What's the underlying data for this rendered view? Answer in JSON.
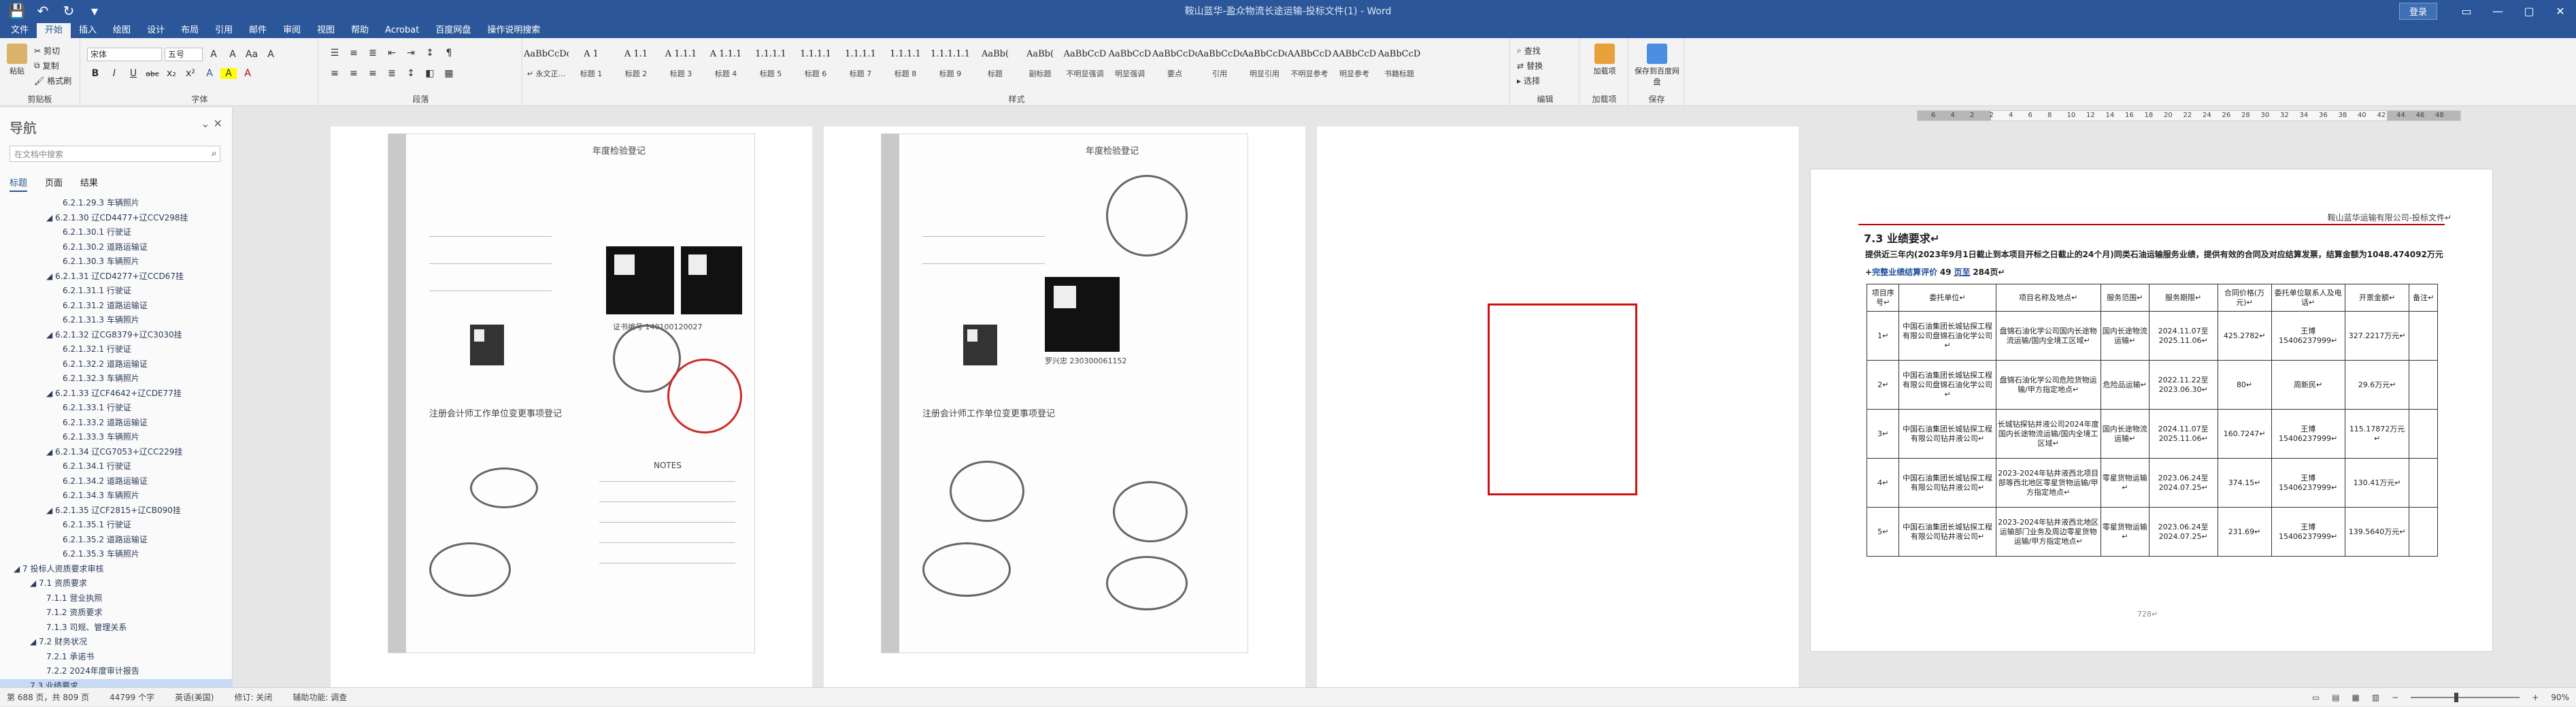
{
  "title_bar": {
    "document_title": "鞍山蓝华-盈众物流长途运输-投标文件(1)  -  Word",
    "sign_in_label": "登录",
    "qat": [
      "💾",
      "↶",
      "↻",
      "▾"
    ],
    "window_controls": [
      "▭",
      "—",
      "▢",
      "✕"
    ]
  },
  "menu": {
    "tabs": [
      "文件",
      "开始",
      "插入",
      "绘图",
      "设计",
      "布局",
      "引用",
      "邮件",
      "审阅",
      "视图",
      "帮助",
      "Acrobat",
      "百度网盘",
      "操作说明搜索"
    ],
    "active_index": 1
  },
  "ribbon": {
    "clipboard": {
      "paste": "粘贴",
      "cut": "剪切",
      "copy": "复制",
      "format_painter": "格式刷",
      "group": "剪贴板"
    },
    "font": {
      "name": "宋体",
      "size": "五号",
      "group": "字体",
      "format_buttons": [
        "B",
        "I",
        "U",
        "abc",
        "x₂",
        "x²",
        "A",
        "A",
        "A"
      ]
    },
    "paragraph": {
      "group": "段落"
    },
    "styles": {
      "group": "样式",
      "items": [
        {
          "sample": "AaBbCcDd",
          "name": "↵ 永文正..."
        },
        {
          "sample": "A 1",
          "name": "标题 1"
        },
        {
          "sample": "A 1.1",
          "name": "标题 2"
        },
        {
          "sample": "A 1.1.1",
          "name": "标题 3"
        },
        {
          "sample": "A 1.1.1",
          "name": "标题 4"
        },
        {
          "sample": "1.1.1.1",
          "name": "标题 5"
        },
        {
          "sample": "1.1.1.1",
          "name": "标题 6"
        },
        {
          "sample": "1.1.1.1",
          "name": "标题 7"
        },
        {
          "sample": "1.1.1.1",
          "name": "标题 8"
        },
        {
          "sample": "1.1.1.1.1",
          "name": "标题 9"
        },
        {
          "sample": "AaBb(",
          "name": "标题"
        },
        {
          "sample": "AaBb(",
          "name": "副标题"
        },
        {
          "sample": "AaBbCcD",
          "name": "不明显强调"
        },
        {
          "sample": "AaBbCcD",
          "name": "明显强调"
        },
        {
          "sample": "AaBbCcDd",
          "name": "要点"
        },
        {
          "sample": "AaBbCcDd",
          "name": "引用"
        },
        {
          "sample": "AaBbCcDd",
          "name": "明显引用"
        },
        {
          "sample": "AABbCcD",
          "name": "不明显参考"
        },
        {
          "sample": "AABbCcD",
          "name": "明显参考"
        },
        {
          "sample": "AaBbCcD",
          "name": "书籍标题"
        }
      ]
    },
    "editing": {
      "find": "查找",
      "replace": "替换",
      "select": "选择",
      "group": "编辑"
    },
    "addin": {
      "label": "加载项",
      "group": "加载项"
    },
    "save": {
      "label": "保存到百度网盘",
      "group": "保存"
    }
  },
  "ruler": {
    "numbers": [
      "6",
      "4",
      "2",
      "2",
      "4",
      "6",
      "8",
      "10",
      "12",
      "14",
      "16",
      "18",
      "20",
      "22",
      "24",
      "26",
      "28",
      "30",
      "32",
      "34",
      "36",
      "38",
      "40",
      "42",
      "44",
      "46",
      "48"
    ]
  },
  "nav": {
    "title": "导航",
    "search_placeholder": "在文档中搜索",
    "tabs": [
      "标题",
      "页面",
      "结果"
    ],
    "items": [
      {
        "text": "6.2.1.29.3  车辆照片",
        "indent": 3
      },
      {
        "text": "◢ 6.2.1.30 辽CD4477+辽CCV298挂",
        "indent": 2
      },
      {
        "text": "6.2.1.30.1  行驶证",
        "indent": 3
      },
      {
        "text": "6.2.1.30.2  道路运输证",
        "indent": 3
      },
      {
        "text": "6.2.1.30.3  车辆照片",
        "indent": 3
      },
      {
        "text": "◢ 6.2.1.31 辽CD4277+辽CCD67挂",
        "indent": 2
      },
      {
        "text": "6.2.1.31.1  行驶证",
        "indent": 3
      },
      {
        "text": "6.2.1.31.2  道路运输证",
        "indent": 3
      },
      {
        "text": "6.2.1.31.3  车辆照片",
        "indent": 3
      },
      {
        "text": "◢ 6.2.1.32 辽CG8379+辽C3030挂",
        "indent": 2
      },
      {
        "text": "6.2.1.32.1  行驶证",
        "indent": 3
      },
      {
        "text": "6.2.1.32.2  道路运输证",
        "indent": 3
      },
      {
        "text": "6.2.1.32.3  车辆照片",
        "indent": 3
      },
      {
        "text": "◢ 6.2.1.33 辽CF4642+辽CDE77挂",
        "indent": 2
      },
      {
        "text": "6.2.1.33.1  行驶证",
        "indent": 3
      },
      {
        "text": "6.2.1.33.2  道路运输证",
        "indent": 3
      },
      {
        "text": "6.2.1.33.3  车辆照片",
        "indent": 3
      },
      {
        "text": "◢ 6.2.1.34 辽CG7053+辽CC229挂",
        "indent": 2
      },
      {
        "text": "6.2.1.34.1  行驶证",
        "indent": 3
      },
      {
        "text": "6.2.1.34.2  道路运输证",
        "indent": 3
      },
      {
        "text": "6.2.1.34.3  车辆照片",
        "indent": 3
      },
      {
        "text": "◢ 6.2.1.35 辽CF2815+辽CB090挂",
        "indent": 2
      },
      {
        "text": "6.2.1.35.1  行驶证",
        "indent": 3
      },
      {
        "text": "6.2.1.35.2  道路运输证",
        "indent": 3
      },
      {
        "text": "6.2.1.35.3  车辆照片",
        "indent": 3
      },
      {
        "text": "◢ 7  投标人资质要求审核",
        "indent": 0
      },
      {
        "text": "◢ 7.1  资质要求",
        "indent": 1
      },
      {
        "text": "7.1.1  营业执照",
        "indent": 2
      },
      {
        "text": "7.1.2  资质要求",
        "indent": 2
      },
      {
        "text": "7.1.3  司规、管理关系",
        "indent": 2
      },
      {
        "text": "◢ 7.2  财务状况",
        "indent": 1
      },
      {
        "text": "7.2.1  承诺书",
        "indent": 2
      },
      {
        "text": "7.2.2  2024年度审计报告",
        "indent": 2
      },
      {
        "text": "7.3  业绩要求",
        "indent": 1,
        "selected": true
      }
    ]
  },
  "scan1": {
    "top_title": "年度检验登记",
    "cert_no": "证书编号 140100120027",
    "bottom_title": "注册会计师工作单位变更事项登记",
    "notes_title": "NOTES"
  },
  "scan2": {
    "top_title": "年度检验登记",
    "cert_no": "罗兴忠 230300061152",
    "bottom_title": "注册会计师工作单位变更事项登记"
  },
  "page4": {
    "header": "鞍山蓝华运输有限公司-投标文件↵",
    "section_title": "7.3 业绩要求↵",
    "intro": "提供近三年内(2023年9月1日截止到本项目开标之日截止的24个月)同类石油运输服务业绩，提供有效的合同及对应结算发票，结算金额为1048.474092万元+",
    "intro2": "完整业绩结算评价",
    "intro3": "49",
    "intro4": "页至",
    "intro5": "284页↵",
    "table": {
      "headers": [
        "项目序号↵",
        "委托单位↵",
        "项目名称及地点↵",
        "服务范围↵",
        "服务期限↵",
        "合同价格(万元)↵",
        "委托单位联系人及电话↵",
        "开票金额↵",
        "备注↵"
      ],
      "rows": [
        [
          "1↵",
          "中国石油集团长城钻探工程有限公司盘锦石油化学公司↵",
          "盘锦石油化学公司国内长途物流运输/国内全境工区域↵",
          "国内长途物流运输↵",
          "2024.11.07至2025.11.06↵",
          "425.2782↵",
          "王博15406237999↵",
          "327.2217万元↵",
          ""
        ],
        [
          "2↵",
          "中国石油集团长城钻探工程有限公司盘锦石油化学公司↵",
          "盘锦石油化学公司危险货物运输/甲方指定地点↵",
          "危险品运输↵",
          "2022.11.22至2023.06.30↵",
          "80↵",
          "周新民↵",
          "29.6万元↵",
          ""
        ],
        [
          "3↵",
          "中国石油集团长城钻探工程有限公司钻井液公司↵",
          "长城钻探钻井液公司2024年度国内长途物流运输/国内全境工区域↵",
          "国内长途物流运输↵",
          "2024.11.07至2025.11.06↵",
          "160.7247↵",
          "王博15406237999↵",
          "115.17872万元↵",
          ""
        ],
        [
          "4↵",
          "中国石油集团长城钻探工程有限公司钻井液公司↵",
          "2023-2024年钻井液西北项目部等西北地区零星货物运输/甲方指定地点↵",
          "零星货物运输↵",
          "2023.06.24至2024.07.25↵",
          "374.15↵",
          "王博15406237999↵",
          "130.41万元↵",
          ""
        ],
        [
          "5↵",
          "中国石油集团长城钻探工程有限公司钻井液公司↵",
          "2023-2024年钻井液西北地区运输部门业务及周边零星货物运输/甲方指定地点↵",
          "零星货物运输↵",
          "2023.06.24至2024.07.25↵",
          "231.69↵",
          "王博15406237999↵",
          "139.5640万元↵",
          ""
        ]
      ]
    },
    "footer": "728↵"
  },
  "status": {
    "page": "第 688 页，共 809 页",
    "words": "44799 个字",
    "lang": "英语(美国)",
    "track": "修订: 关闭",
    "accessibility": "辅助功能: 调查",
    "zoom": "90%"
  }
}
